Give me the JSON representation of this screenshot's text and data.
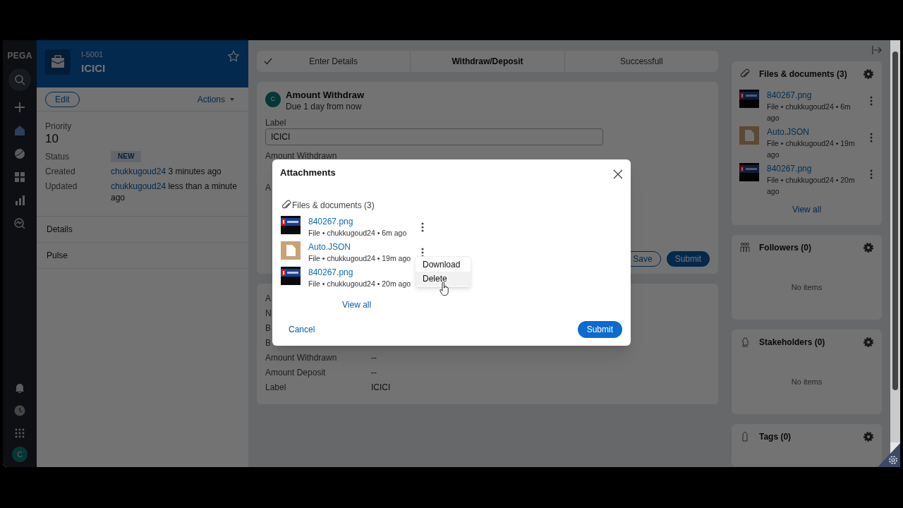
{
  "nav": {
    "logo": "PEGA",
    "avatar": "C",
    "items": [
      {
        "kind": "search",
        "selected": false
      },
      {
        "kind": "plus",
        "selected": false
      },
      {
        "kind": "home",
        "selected": true
      },
      {
        "kind": "globe",
        "selected": false
      },
      {
        "kind": "grid",
        "selected": false
      },
      {
        "kind": "bars",
        "selected": false
      },
      {
        "kind": "insight",
        "selected": false
      }
    ],
    "bottom": [
      {
        "kind": "bell"
      },
      {
        "kind": "history"
      },
      {
        "kind": "apps"
      }
    ]
  },
  "case": {
    "id": "I-5001",
    "title": "ICICI",
    "edit": "Edit",
    "actions": "Actions",
    "priority_label": "Priority",
    "priority": "10",
    "fields": [
      {
        "label": "Status",
        "kind": "badge",
        "value": "NEW"
      },
      {
        "label": "Created",
        "kind": "user",
        "user": "chukkugoud24",
        "time": "3 minutes ago"
      },
      {
        "label": "Updated",
        "kind": "user",
        "user": "chukkugoud24",
        "time": "less than a minute ago"
      }
    ],
    "tabs": [
      "Details",
      "Pulse"
    ]
  },
  "stages": [
    {
      "label": "Enter Details",
      "done": true,
      "selected": false
    },
    {
      "label": "Withdraw/Deposit",
      "done": false,
      "selected": true
    },
    {
      "label": "Successfull",
      "done": false,
      "selected": false
    }
  ],
  "assignment": {
    "avatar": "C",
    "title": "Amount Withdraw",
    "due": "Due 1 day from now",
    "field_label": "Label",
    "field_value": "ICICI",
    "next_label": "Amount Withdrawn",
    "third_label": "A",
    "save": "Save",
    "submit": "Submit"
  },
  "summary": [
    {
      "label": "A"
    },
    {
      "label": "N"
    },
    {
      "label": "B"
    },
    {
      "label": "B"
    },
    {
      "label": "Amount Withdrawn",
      "value": "--"
    },
    {
      "label": "Amount Deposit",
      "value": "--"
    },
    {
      "label": "Label",
      "value": "ICICI"
    }
  ],
  "widgets": [
    {
      "kind": "files",
      "title": "Files & documents (3)",
      "link": "View all",
      "items": [
        {
          "name": "840267.png",
          "meta": "File • chukkugoud24 • 6m ago"
        },
        {
          "name": "Auto.JSON",
          "kind": "document",
          "meta": "File • chukkugoud24 • 19m ago"
        },
        {
          "name": "840267.png",
          "meta": "File • chukkugoud24 • 20m ago"
        }
      ]
    },
    {
      "kind": "followers",
      "title": "Followers (0)",
      "empty": "No items"
    },
    {
      "kind": "stakeholders",
      "title": "Stakeholders (0)",
      "empty": "No items"
    },
    {
      "kind": "tags",
      "title": "Tags (0)"
    }
  ],
  "modal": {
    "title": "Attachments",
    "section": "Files & documents (3)",
    "link": "View all",
    "cancel": "Cancel",
    "submit": "Submit",
    "files": [
      {
        "name": "840267.png",
        "meta": "File • chukkugoud24 • 6m ago"
      },
      {
        "name": "Auto.JSON",
        "kind": "document",
        "meta": "File • chukkugoud24 • 19m ago"
      },
      {
        "name": "840267.png",
        "meta": "File • chukkugoud24 • 20m ago"
      }
    ],
    "menu": [
      {
        "label": "Download",
        "selected": false
      },
      {
        "label": "Delete",
        "selected": true
      }
    ]
  }
}
